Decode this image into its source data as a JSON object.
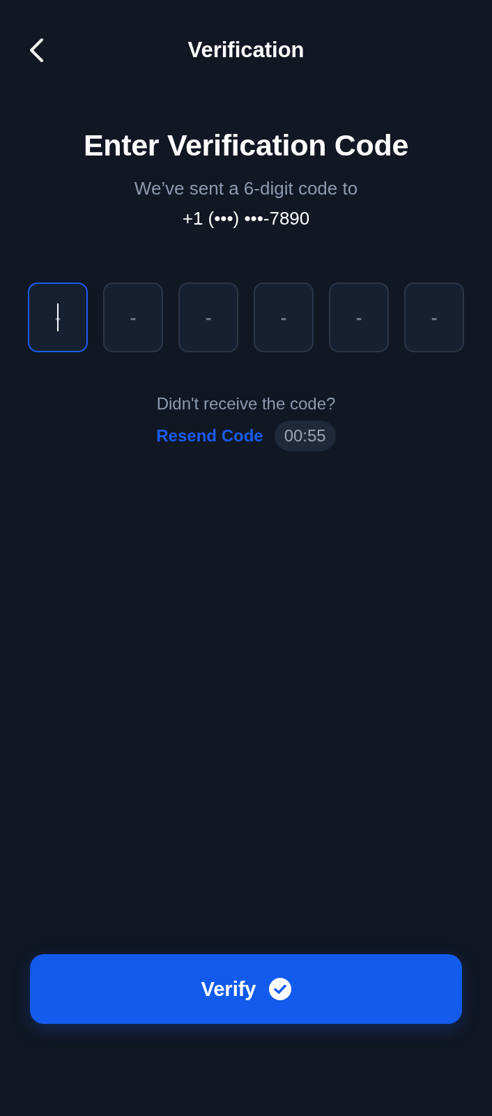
{
  "header": {
    "title": "Verification"
  },
  "heading": "Enter Verification Code",
  "subtitle": "We’ve sent a 6-digit code to",
  "phone": "+1 (•••) •••-7890",
  "code_boxes": [
    {
      "placeholder": "-",
      "selected": true
    },
    {
      "placeholder": "-",
      "selected": false
    },
    {
      "placeholder": "-",
      "selected": false
    },
    {
      "placeholder": "-",
      "selected": false
    },
    {
      "placeholder": "-",
      "selected": false
    },
    {
      "placeholder": "-",
      "selected": false
    }
  ],
  "resend": {
    "prompt": "Didn't receive the code?",
    "link": "Resend Code",
    "timer": "00:55"
  },
  "verify_button": {
    "label": "Verify"
  }
}
